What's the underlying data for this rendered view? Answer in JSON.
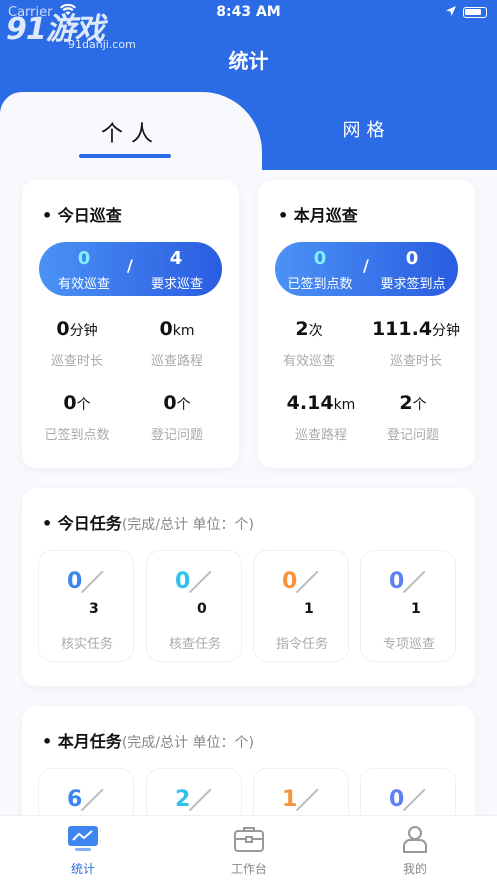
{
  "status": {
    "carrier": "Carrier",
    "time": "8:43 AM"
  },
  "watermark": {
    "main": "91游戏",
    "sub": "91danji.com"
  },
  "header": {
    "title": "统计"
  },
  "tabs": [
    {
      "label": "个人",
      "active": true
    },
    {
      "label": "网格",
      "active": false
    }
  ],
  "today_patrol": {
    "title": "今日巡查",
    "pill": {
      "left_value": "0",
      "left_label": "有效巡查",
      "right_value": "4",
      "right_label": "要求巡查"
    },
    "stats": [
      {
        "value": "0",
        "unit": "分钟",
        "label": "巡查时长"
      },
      {
        "value": "0",
        "unit": "km",
        "label": "巡查路程"
      },
      {
        "value": "0",
        "unit": "个",
        "label": "已签到点数"
      },
      {
        "value": "0",
        "unit": "个",
        "label": "登记问题"
      }
    ]
  },
  "month_patrol": {
    "title": "本月巡查",
    "pill": {
      "left_value": "0",
      "left_label": "已签到点数",
      "right_value": "0",
      "right_label": "要求签到点"
    },
    "stats": [
      {
        "value": "2",
        "unit": "次",
        "label": "有效巡查"
      },
      {
        "value": "111.4",
        "unit": "分钟",
        "label": "巡查时长"
      },
      {
        "value": "4.14",
        "unit": "km",
        "label": "巡查路程"
      },
      {
        "value": "2",
        "unit": "个",
        "label": "登记问题"
      }
    ]
  },
  "today_tasks": {
    "title": "今日任务",
    "note": "(完成/总计 单位：个)",
    "items": [
      {
        "done": "0",
        "total": "3",
        "label": "核实任务",
        "color": "#3d86f0"
      },
      {
        "done": "0",
        "total": "0",
        "label": "核查任务",
        "color": "#2fc0ef"
      },
      {
        "done": "0",
        "total": "1",
        "label": "指令任务",
        "color": "#f7943a"
      },
      {
        "done": "0",
        "total": "1",
        "label": "专项巡查",
        "color": "#5e80f0"
      }
    ]
  },
  "month_tasks": {
    "title": "本月任务",
    "note": "(完成/总计 单位：个)",
    "items": [
      {
        "done": "6"
      },
      {
        "done": "2"
      },
      {
        "done": "1"
      },
      {
        "done": "0"
      }
    ]
  },
  "tabbar": [
    {
      "label": "统计",
      "icon": "chart-icon",
      "active": true
    },
    {
      "label": "工作台",
      "icon": "briefcase-icon",
      "active": false
    },
    {
      "label": "我的",
      "icon": "user-icon",
      "active": false
    }
  ],
  "colors": {
    "primary": "#2b6ce6",
    "accent_cyan": "#7ff0ff",
    "bg": "#f7f9fc"
  }
}
